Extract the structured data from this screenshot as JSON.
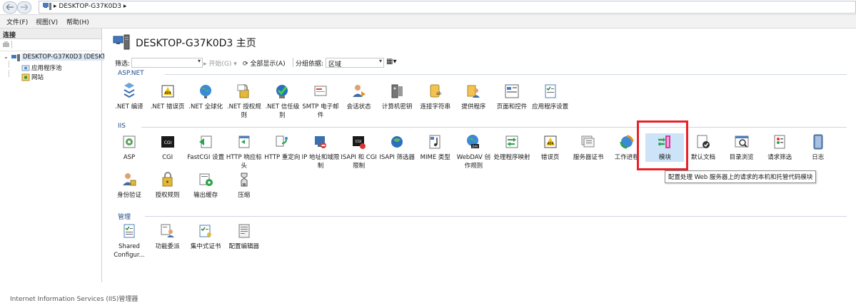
{
  "address_bar": {
    "path": "DESKTOP-G37K0D3"
  },
  "menu": {
    "items": [
      "文件(F)",
      "视图(V)",
      "帮助(H)"
    ]
  },
  "connections": {
    "header": "连接",
    "tree": [
      {
        "label": "DESKTOP-G37K0D3 (DESKT"
      },
      {
        "label": "应用程序池"
      },
      {
        "label": "网站"
      }
    ]
  },
  "main": {
    "title": "DESKTOP-G37K0D3 主页",
    "filter": {
      "label": "筛选:",
      "start": "开始(G)",
      "show_all": "全部显示(A)",
      "group_by_label": "分组依据:",
      "group_by_value": "区域"
    },
    "sections": [
      {
        "name": "ASP.NET",
        "items": [
          {
            "label": ".NET 编译",
            "icon": "net-compile-icon"
          },
          {
            "label": ".NET 错误页",
            "icon": "net-error-page-icon"
          },
          {
            "label": ".NET 全球化",
            "icon": "globe-icon"
          },
          {
            "label": ".NET 授权规则",
            "icon": "lock-icon"
          },
          {
            "label": ".NET 信任级别",
            "icon": "trust-check-icon"
          },
          {
            "label": "SMTP 电子邮件",
            "icon": "email-icon"
          },
          {
            "label": "会话状态",
            "icon": "session-user-icon"
          },
          {
            "label": "计算机密钥",
            "icon": "machine-key-icon"
          },
          {
            "label": "连接字符串",
            "icon": "connection-string-icon"
          },
          {
            "label": "提供程序",
            "icon": "provider-icon"
          },
          {
            "label": "页面和控件",
            "icon": "page-controls-icon"
          },
          {
            "label": "应用程序设置",
            "icon": "app-settings-icon"
          }
        ]
      },
      {
        "name": "IIS",
        "items": [
          {
            "label": "ASP",
            "icon": "asp-icon"
          },
          {
            "label": "CGI",
            "icon": "cgi-icon"
          },
          {
            "label": "FastCGI 设置",
            "icon": "fastcgi-icon"
          },
          {
            "label": "HTTP 响应标头",
            "icon": "http-header-icon"
          },
          {
            "label": "HTTP 重定向",
            "icon": "redirect-icon"
          },
          {
            "label": "IP 地址和域限制",
            "icon": "ip-restrict-icon"
          },
          {
            "label": "ISAPI 和 CGI 限制",
            "icon": "isapi-cgi-icon"
          },
          {
            "label": "ISAPI 筛选器",
            "icon": "isapi-filter-icon"
          },
          {
            "label": "MIME 类型",
            "icon": "mime-icon"
          },
          {
            "label": "WebDAV 创作规则",
            "icon": "webdav-icon"
          },
          {
            "label": "处理程序映射",
            "icon": "handler-map-icon"
          },
          {
            "label": "错误页",
            "icon": "error-page-icon"
          },
          {
            "label": "服务器证书",
            "icon": "server-cert-icon"
          },
          {
            "label": "工作进程",
            "icon": "worker-process-icon"
          },
          {
            "label": "模块",
            "icon": "modules-icon"
          },
          {
            "label": "默认文档",
            "icon": "default-doc-icon"
          },
          {
            "label": "目录浏览",
            "icon": "dir-browse-icon"
          },
          {
            "label": "请求筛选",
            "icon": "request-filter-icon"
          },
          {
            "label": "日志",
            "icon": "log-icon"
          },
          {
            "label": "身份验证",
            "icon": "auth-icon"
          },
          {
            "label": "授权规则",
            "icon": "authz-icon"
          },
          {
            "label": "输出缓存",
            "icon": "output-cache-icon"
          },
          {
            "label": "压缩",
            "icon": "compress-icon"
          }
        ]
      },
      {
        "name": "管理",
        "items": [
          {
            "label": "Shared Configur...",
            "icon": "shared-config-icon"
          },
          {
            "label": "功能委派",
            "icon": "feature-delegation-icon"
          },
          {
            "label": "集中式证书",
            "icon": "central-cert-icon"
          },
          {
            "label": "配置编辑器",
            "icon": "config-editor-icon"
          }
        ]
      }
    ],
    "tooltip": "配置处理 Web 服务器上的请求的本机和托管代码模块"
  },
  "status": {
    "text": "Internet Information Services (IIS)管理器"
  },
  "colors": {
    "accent": "#1f4e8a",
    "highlight": "#e8212a",
    "selected": "#cde3f7"
  }
}
